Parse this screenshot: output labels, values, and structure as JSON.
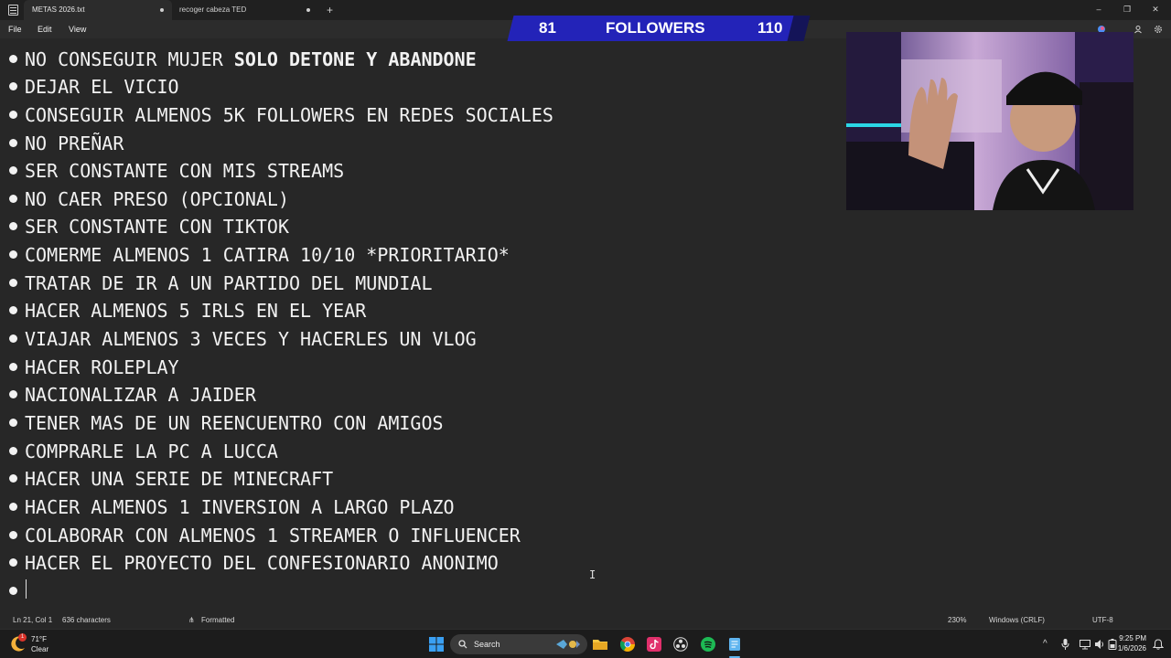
{
  "tabs": [
    {
      "label": "METAS 2026.txt",
      "active": true
    },
    {
      "label": "recoger cabeza TED",
      "active": false
    }
  ],
  "window_controls": [
    "–",
    "❐",
    "✕"
  ],
  "menu": [
    "File",
    "Edit",
    "View"
  ],
  "overlay": {
    "left_count": "81",
    "label": "FOLLOWERS",
    "right_count": "110",
    "color": "#2323b8"
  },
  "lines": [
    {
      "plain": "NO CONSEGUIR MUJER ",
      "bold": "SOLO DETONE Y ABANDONE"
    },
    {
      "plain": "DEJAR EL VICIO"
    },
    {
      "plain": "CONSEGUIR ALMENOS 5K FOLLOWERS EN REDES SOCIALES"
    },
    {
      "plain": "NO PREÑAR"
    },
    {
      "plain": "SER CONSTANTE CON MIS STREAMS"
    },
    {
      "plain": "NO CAER PRESO (OPCIONAL)"
    },
    {
      "plain": "SER CONSTANTE CON TIKTOK"
    },
    {
      "plain": "COMERME ALMENOS 1 CATIRA 10/10 *PRIORITARIO*"
    },
    {
      "plain": "TRATAR DE IR A UN PARTIDO DEL MUNDIAL"
    },
    {
      "plain": "HACER ALMENOS 5 IRLS EN EL YEAR"
    },
    {
      "plain": "VIAJAR ALMENOS 3 VECES Y HACERLES UN VLOG"
    },
    {
      "plain": "HACER ROLEPLAY"
    },
    {
      "plain": "NACIONALIZAR A JAIDER"
    },
    {
      "plain": "TENER MAS DE UN REENCUENTRO CON AMIGOS"
    },
    {
      "plain": "COMPRARLE LA PC A LUCCA"
    },
    {
      "plain": "HACER UNA SERIE DE MINECRAFT"
    },
    {
      "plain": "HACER ALMENOS 1 INVERSION A LARGO PLAZO"
    },
    {
      "plain": "COLABORAR CON ALMENOS 1 STREAMER O INFLUENCER"
    },
    {
      "plain": "HACER EL PROYECTO DEL CONFESIONARIO ANONIMO"
    },
    {
      "plain": ""
    }
  ],
  "status": {
    "position": "Ln 21, Col 1",
    "chars": "636 characters",
    "format": "Formatted",
    "zoom": "230%",
    "line_ending": "Windows (CRLF)",
    "encoding": "UTF-8"
  },
  "taskbar": {
    "weather_temp": "71°F",
    "weather_desc": "Clear",
    "weather_badge": "1",
    "search_label": "Search",
    "time": "9:25 PM",
    "date": "1/6/2026"
  },
  "colors": {
    "editor_bg": "#272727",
    "text": "#f2f2f2",
    "spotify": "#1db954",
    "tiktok": "#e1306c"
  }
}
